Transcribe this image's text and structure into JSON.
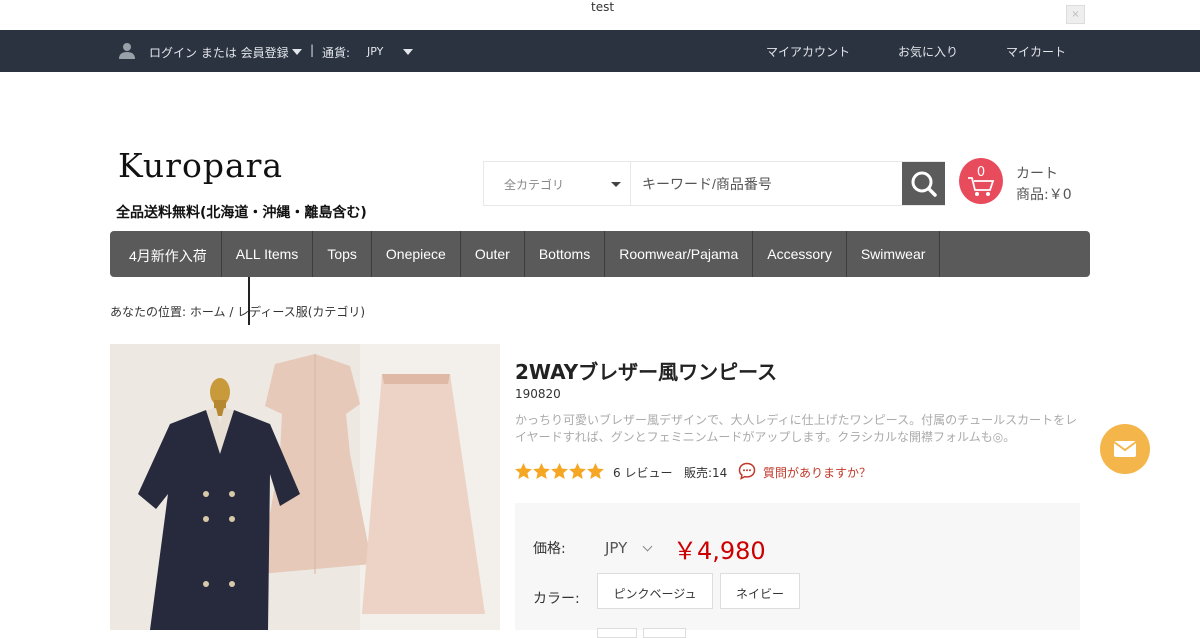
{
  "notice": {
    "text": "test",
    "close": "×"
  },
  "topbar": {
    "login": "ログイン または 会員登録",
    "separator": "|",
    "currency_label": "通貨:",
    "currency_value": "JPY",
    "links": [
      "マイアカウント",
      "お気に入り",
      "マイカート"
    ]
  },
  "brand": {
    "logo": "Kuropara",
    "tagline": "全品送料無料(北海道・沖縄・離島含む)"
  },
  "search": {
    "category": "全カテゴリ",
    "placeholder": "キーワード/商品番号",
    "icon": "search-icon"
  },
  "cart": {
    "count": "0",
    "label": "カート",
    "items": "商品:￥0"
  },
  "nav": [
    "4月新作入荷",
    "ALL Items",
    "Tops",
    "Onepiece",
    "Outer",
    "Bottoms",
    "Roomwear/Pajama",
    "Accessory",
    "Swimwear"
  ],
  "breadcrumb": "あなたの位置: ホーム / レディース服(カテゴリ)",
  "product": {
    "title": "2WAYブレザー風ワンピース",
    "code": "190820",
    "description": "かっちり可愛いブレザー風デザインで、大人レディに仕上げたワンピース。付属のチュールスカートをレイヤードすれば、グンとフェミニンムードがアップします。クラシカルな開襟フォルムも◎。",
    "rating": 5,
    "reviews": "6 レビュー",
    "sold": "販売:14",
    "question": "質問がありますか？",
    "price_label": "価格:",
    "price_currency": "JPY",
    "price": "￥4,980",
    "color_label": "カラー:",
    "colors": [
      "ピンクベージュ",
      "ネイビー"
    ]
  },
  "colors": {
    "topbar": "#2b3341",
    "nav": "#5a5a5a",
    "price": "#cc0000",
    "cart": "#e84b5b",
    "mail": "#f4b64a"
  }
}
